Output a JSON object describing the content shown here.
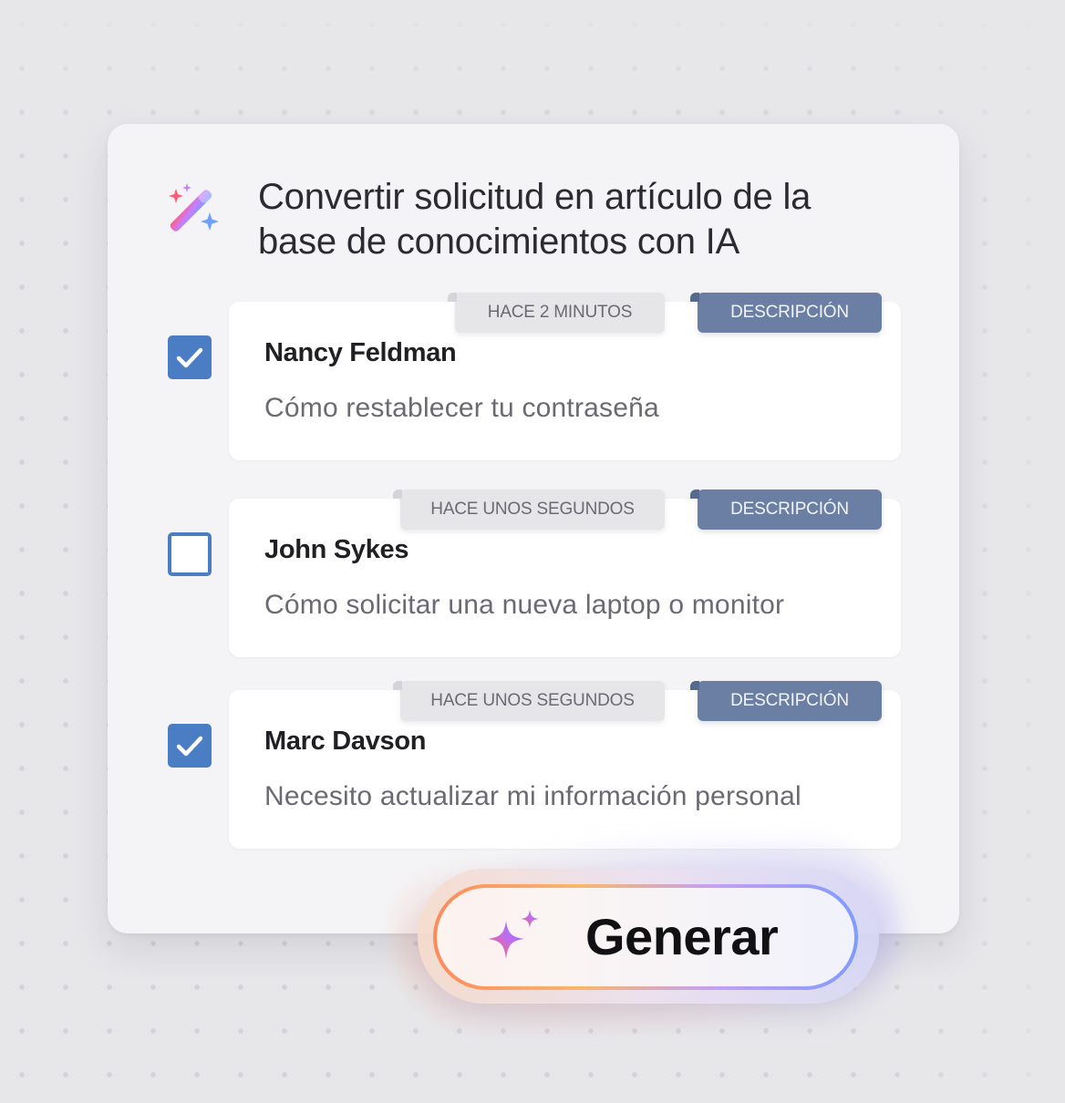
{
  "dialog": {
    "title": "Convertir solicitud en artículo de la base de conocimientos con IA",
    "title_icon": "magic-wand-sparkles-icon"
  },
  "items": [
    {
      "checked": true,
      "time_tag": "HACE 2 MINUTOS",
      "type_tag": "DESCRIPCIÓN",
      "name": "Nancy Feldman",
      "subject": "Cómo restablecer tu contraseña"
    },
    {
      "checked": false,
      "time_tag": "HACE UNOS SEGUNDOS",
      "type_tag": "DESCRIPCIÓN",
      "name": "John Sykes",
      "subject": "Cómo solicitar una nueva laptop o monitor"
    },
    {
      "checked": true,
      "time_tag": "HACE UNOS SEGUNDOS",
      "type_tag": "DESCRIPCIÓN",
      "name": "Marc Davson",
      "subject": "Necesito actualizar mi información personal"
    }
  ],
  "generate_button": {
    "label": "Generar",
    "icon": "sparkle-icon"
  },
  "colors": {
    "background": "#e7e7ea",
    "card": "#f4f4f6",
    "checkbox": "#4a7dc4",
    "description_tag": "#6b7ea3",
    "time_tag": "#e6e6e9",
    "gradient_start": "#ff8a5c",
    "gradient_end": "#7f9cff"
  }
}
